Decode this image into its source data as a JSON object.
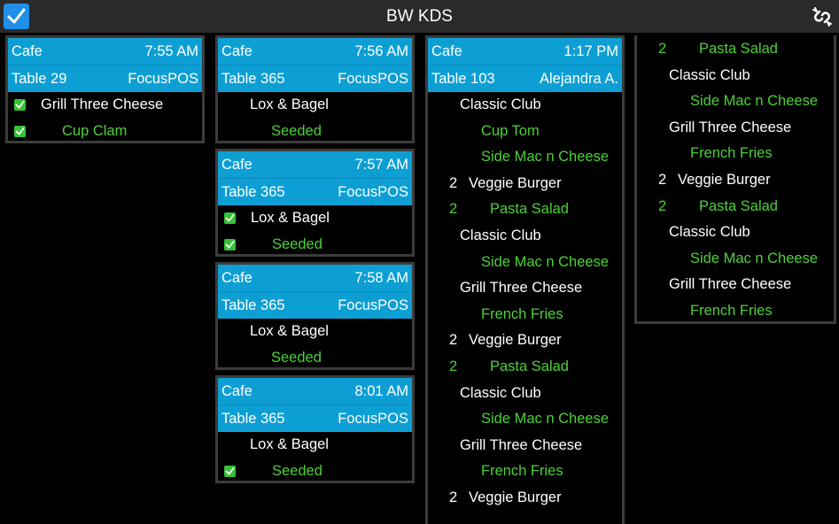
{
  "app": {
    "title": "BW KDS"
  },
  "colors": {
    "header": "#0d9fd4",
    "modifier": "#4cd137",
    "topbar": "#2a2a2a",
    "accent": "#1f8fe8"
  },
  "icons": {
    "select_all": "checkmark-icon",
    "sync": "sync-link-icon",
    "item_done": "check-box-icon"
  },
  "tickets": [
    {
      "location": "Cafe",
      "time": "7:55 AM",
      "table": "Table 29",
      "server": "FocusPOS",
      "items": [
        {
          "text": "Grill Three Cheese",
          "type": "main",
          "checked": true
        },
        {
          "text": "Cup Clam",
          "type": "mod",
          "checked": true
        }
      ]
    },
    {
      "location": "Cafe",
      "time": "7:56 AM",
      "table": "Table 365",
      "server": "FocusPOS",
      "items": [
        {
          "text": "Lox & Bagel",
          "type": "main",
          "checked": false
        },
        {
          "text": "Seeded",
          "type": "mod",
          "checked": false
        }
      ]
    },
    {
      "location": "Cafe",
      "time": "7:57 AM",
      "table": "Table 365",
      "server": "FocusPOS",
      "items": [
        {
          "text": "Lox & Bagel",
          "type": "main",
          "checked": true
        },
        {
          "text": "Seeded",
          "type": "mod",
          "checked": true
        }
      ]
    },
    {
      "location": "Cafe",
      "time": "7:58 AM",
      "table": "Table 365",
      "server": "FocusPOS",
      "items": [
        {
          "text": "Lox & Bagel",
          "type": "main",
          "checked": false
        },
        {
          "text": "Seeded",
          "type": "mod",
          "checked": false
        }
      ]
    },
    {
      "location": "Cafe",
      "time": "8:01 AM",
      "table": "Table 365",
      "server": "FocusPOS",
      "items": [
        {
          "text": "Lox & Bagel",
          "type": "main",
          "checked": false
        },
        {
          "text": "Seeded",
          "type": "mod",
          "checked": true
        }
      ]
    },
    {
      "location": "Cafe",
      "time": "1:17 PM",
      "table": "Table 103",
      "server": "Alejandra A.",
      "items": [
        {
          "text": "Classic Club",
          "type": "main"
        },
        {
          "text": "Cup Tom",
          "type": "mod"
        },
        {
          "text": "Side Mac n Cheese",
          "type": "mod"
        },
        {
          "qty": "2",
          "text": "Veggie Burger",
          "type": "mainqty"
        },
        {
          "qty": "2",
          "text": "Pasta Salad",
          "type": "modqty"
        },
        {
          "text": "Classic Club",
          "type": "main"
        },
        {
          "text": "Side Mac n Cheese",
          "type": "mod"
        },
        {
          "text": "Grill Three Cheese",
          "type": "main"
        },
        {
          "text": "French Fries",
          "type": "mod"
        },
        {
          "qty": "2",
          "text": "Veggie Burger",
          "type": "mainqty"
        },
        {
          "qty": "2",
          "text": "Pasta Salad",
          "type": "modqty"
        },
        {
          "text": "Classic Club",
          "type": "main"
        },
        {
          "text": "Side Mac n Cheese",
          "type": "mod"
        },
        {
          "text": "Grill Three Cheese",
          "type": "main"
        },
        {
          "text": "French Fries",
          "type": "mod"
        },
        {
          "qty": "2",
          "text": "Veggie Burger",
          "type": "mainqty"
        }
      ],
      "continued": [
        {
          "qty": "2",
          "text": "Pasta Salad",
          "type": "modqty"
        },
        {
          "text": "Classic Club",
          "type": "main"
        },
        {
          "text": "Side Mac n Cheese",
          "type": "mod"
        },
        {
          "text": "Grill Three Cheese",
          "type": "main"
        },
        {
          "text": "French Fries",
          "type": "mod"
        },
        {
          "qty": "2",
          "text": "Veggie Burger",
          "type": "mainqty"
        },
        {
          "qty": "2",
          "text": "Pasta Salad",
          "type": "modqty"
        },
        {
          "text": "Classic Club",
          "type": "main"
        },
        {
          "text": "Side Mac n Cheese",
          "type": "mod"
        },
        {
          "text": "Grill Three Cheese",
          "type": "main"
        },
        {
          "text": "French Fries",
          "type": "mod"
        }
      ]
    }
  ]
}
